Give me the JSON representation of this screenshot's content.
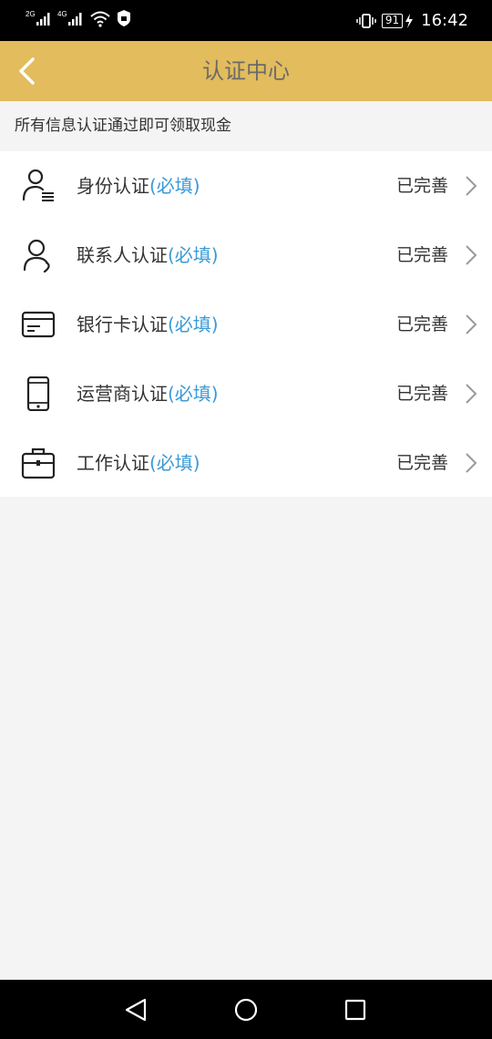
{
  "status_bar": {
    "signal1": "2G",
    "signal2": "4G",
    "battery": "91",
    "time": "16:42"
  },
  "header": {
    "title": "认证中心"
  },
  "notice": "所有信息认证通过即可领取现金",
  "items": [
    {
      "label": "身份认证",
      "required": "(必填)",
      "status": "已完善",
      "icon": "id-card-person-icon"
    },
    {
      "label": "联系人认证",
      "required": "(必填)",
      "status": "已完善",
      "icon": "contact-person-icon"
    },
    {
      "label": "银行卡认证",
      "required": "(必填)",
      "status": "已完善",
      "icon": "bank-card-icon"
    },
    {
      "label": "运营商认证",
      "required": "(必填)",
      "status": "已完善",
      "icon": "mobile-phone-icon"
    },
    {
      "label": "工作认证",
      "required": "(必填)",
      "status": "已完善",
      "icon": "briefcase-icon"
    }
  ],
  "colors": {
    "header_bg": "#e2bc5d",
    "required_text": "#3a9ad6",
    "page_bg": "#f4f4f4"
  }
}
